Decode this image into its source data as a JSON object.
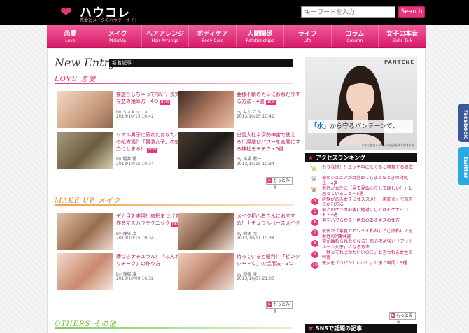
{
  "header": {
    "logo_mark": "❤",
    "logo_text": "ハウコレ",
    "logo_sub": "恋愛とメイクのハウツーサイト",
    "search_placeholder": "キーワードを入力",
    "search_button": "Search"
  },
  "nav": [
    {
      "jp": "恋愛",
      "en": "Love"
    },
    {
      "jp": "メイク",
      "en": "MakeUp"
    },
    {
      "jp": "ヘアアレンジ",
      "en": "Hair Arrange"
    },
    {
      "jp": "ボディケア",
      "en": "Body Care"
    },
    {
      "jp": "人間関係",
      "en": "Relationships"
    },
    {
      "jp": "ライフ",
      "en": "Life"
    },
    {
      "jp": "コラム",
      "en": "Column"
    },
    {
      "jp": "女子の本音",
      "en": "Girl's Talk"
    }
  ],
  "new_entry": {
    "title": "New Entry",
    "label": "新着記事"
  },
  "love": {
    "title": "LOVE 恋愛",
    "more": "もっとみる",
    "articles": [
      {
        "title": "妄想りしちゃってない？良質な恋の始め方・4つ",
        "author": "by Ｓａｋｕｒａ",
        "date": "2013/10/15 10:42",
        "badge": "NEW"
      },
      {
        "title": "亜様不精のカレにおねだりする方法・4選",
        "author": "by 井上 こん",
        "date": "2013/10/15 10:41",
        "badge": "NEW"
      },
      {
        "title": "リアル男子に疲れたあなたへの処方箋？「男装女子」の魅力にせまる！",
        "author": "by 堀井 優",
        "date": "2013/10/15 10:34",
        "badge": "NEW"
      },
      {
        "title": "出雲大社＆伊勢神宮で使える！縁結びパワーを全開にする神社モテテク・5選",
        "author": "by 馬場 麗一",
        "date": "2013/10/15 10:34",
        "badge": "NEW"
      }
    ]
  },
  "makeup": {
    "title": "MAKE UP メイク",
    "more": "もっとみる",
    "articles": [
      {
        "title": "デカ目を実現！扇形まつげを作るマスカラテクニック",
        "author": "by 弾塚 凌",
        "date": "2013/10/15 10:34",
        "badge": "NEW"
      },
      {
        "title": "メイク初心者さんにおすすめ！ナチュラルベースメイク",
        "author": "by 弾塚 凌",
        "date": "2013/10/11 10:38",
        "badge": ""
      },
      {
        "title": "薄づきナチュラル！「ふんわりチーク」の作り方",
        "author": "by 弾塚 凌",
        "date": "2013/10/09 16:32",
        "badge": ""
      },
      {
        "title": "持っていると便利！「ピンクシャドウ」の活用法・3つ",
        "author": "by 弾塚 凌",
        "date": "2013/10/07 21:00",
        "badge": ""
      }
    ]
  },
  "others": {
    "title": "OTHERS その他"
  },
  "ad": {
    "brand": "PANTENE",
    "copy_highlight": "「水」",
    "copy_rest": "から守るパンテーンで、",
    "note": "※水に触れるダメージ成分を取り除きます"
  },
  "ranking": {
    "title": "アクセスランキング",
    "more": "もっとみる",
    "items": [
      {
        "rank": "1",
        "text": "もう我慢！？エッチ中になでると興奮する部位"
      },
      {
        "rank": "2",
        "text": "彼のジュニアが目覚めてしまったときの対処法・4選"
      },
      {
        "rank": "3",
        "text": "男性が女性に「見て見ぬふりしてほしい！」と思っていること・5選"
      },
      {
        "rank": "4",
        "text": "経験がある女子にオススメ！「裏筋さ」で恋をつかむ方法"
      },
      {
        "rank": "5",
        "text": "彼とのケンカの後に絶対にしてはイケナイコト・4選"
      },
      {
        "rank": "6",
        "text": "男をハマらせる！色気のあるキスの仕方"
      },
      {
        "rank": "7",
        "text": "彼氏が「素直でカワイイ私ね」と心底私に入る女性の行動4選"
      },
      {
        "rank": "8",
        "text": "彼が離れられなくなる？恋心攻め強い「アットホーム女子」になる方法"
      },
      {
        "rank": "9",
        "text": "「黙ってればかわいいのに」と言われる女性の特徴"
      },
      {
        "rank": "10",
        "text": "彼女を「ウザかわいい！」と思う瞬間・5選"
      }
    ]
  },
  "sns": {
    "title": "SNSで話題の記事"
  },
  "social": {
    "facebook": "facebook",
    "twitter": "twitter"
  },
  "colors": {
    "accent": "#e6357a",
    "nav_top": "#f05b97",
    "nav_bottom": "#d81c6a"
  }
}
